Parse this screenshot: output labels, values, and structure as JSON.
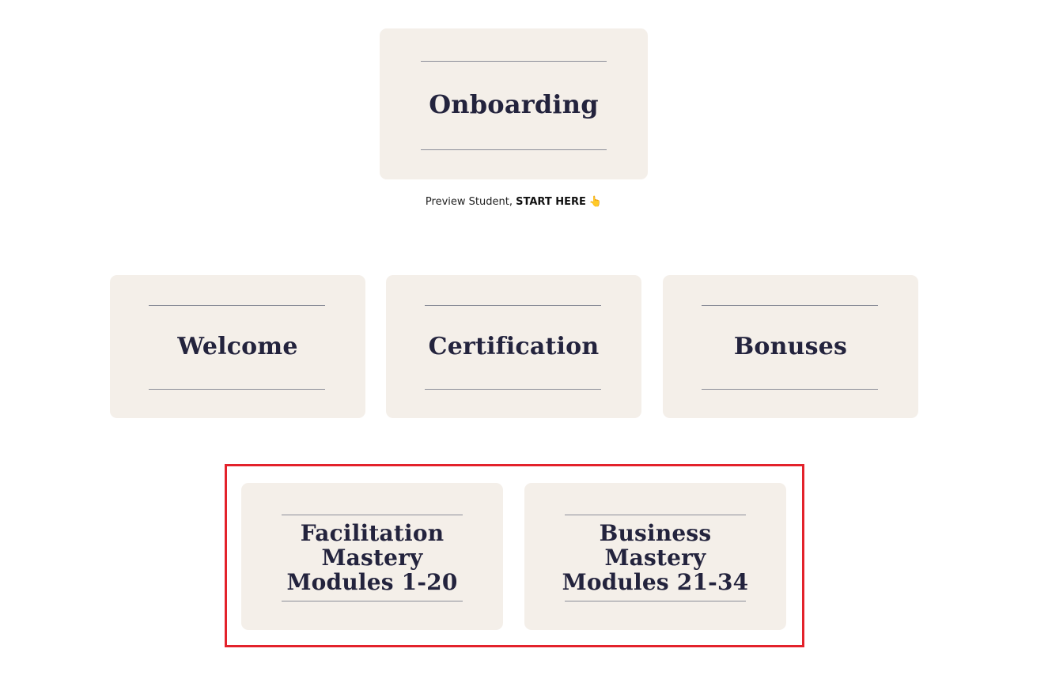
{
  "cards": {
    "onboarding": {
      "title": "Onboarding"
    },
    "welcome": {
      "title": "Welcome"
    },
    "certification": {
      "title": "Certification"
    },
    "bonuses": {
      "title": "Bonuses"
    },
    "facilitation": {
      "lines": [
        "Facilitation",
        "Mastery",
        "Modules 1-20"
      ]
    },
    "business": {
      "lines": [
        "Business",
        "Mastery",
        "Modules 21-34"
      ]
    }
  },
  "caption": {
    "prefix": "Preview Student, ",
    "emphasis": "START HERE",
    "icon": "👆"
  },
  "highlight": {
    "color": "#e3222b"
  },
  "colors": {
    "card_bg": "#f4efe9",
    "title_text": "#23233d"
  }
}
